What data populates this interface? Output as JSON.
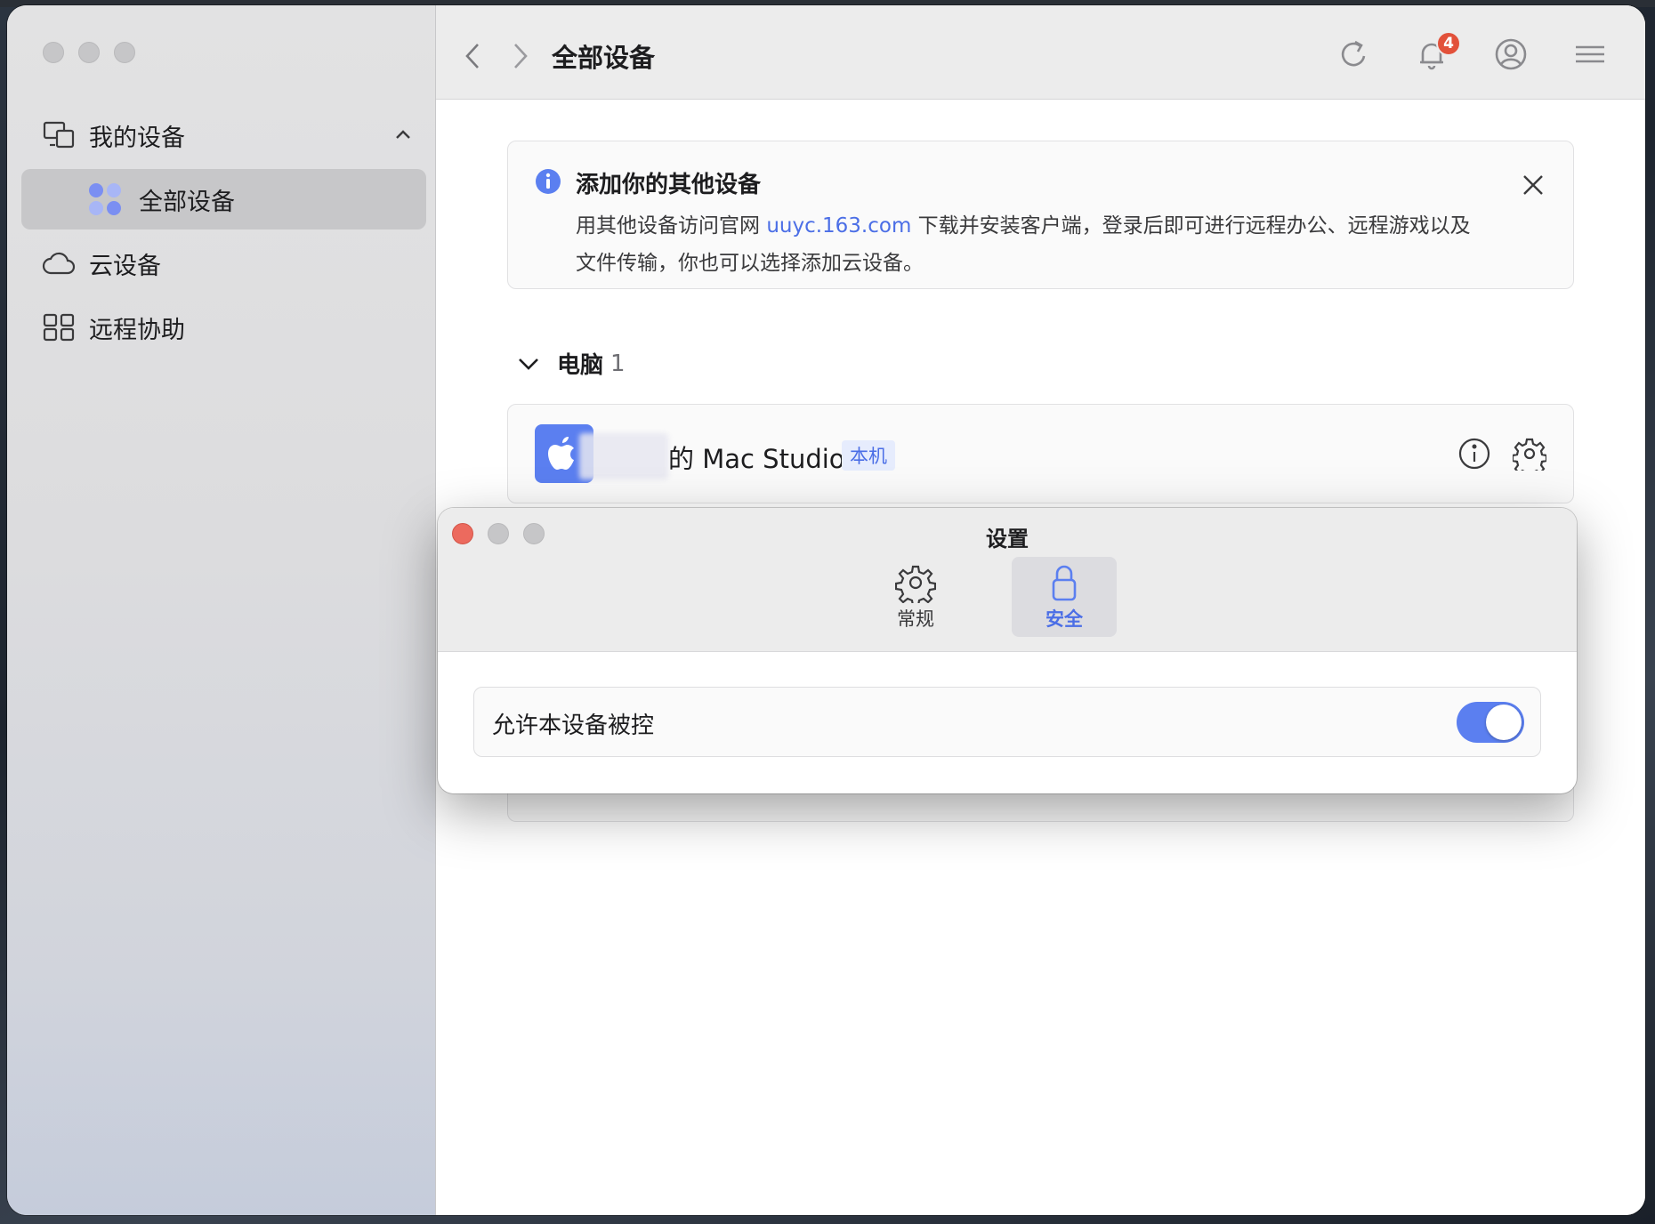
{
  "sidebar": {
    "group_label": "我的设备",
    "items": [
      {
        "label": "全部设备"
      },
      {
        "label": "云设备"
      },
      {
        "label": "远程协助"
      }
    ]
  },
  "titlebar": {
    "title": "全部设备",
    "notification_count": "4"
  },
  "banner": {
    "title": "添加你的其他设备",
    "text_before": "用其他设备访问官网 ",
    "link": "uuyc.163.com",
    "text_after": " 下载并安装客户端，登录后即可进行远程办公、远程游戏以及文件传输，你也可以选择添加云设备。"
  },
  "section": {
    "title": "电脑",
    "count": "1"
  },
  "device": {
    "name": "的 Mac Studio",
    "tag": "本机"
  },
  "dialog": {
    "title": "设置",
    "tabs": [
      {
        "label": "常规"
      },
      {
        "label": "安全"
      }
    ],
    "active_tab": "安全",
    "setting_label": "允许本设备被控",
    "setting_enabled": true
  },
  "colors": {
    "accent": "#5b7ff0",
    "badge": "#e2513a",
    "close_red": "#ec6a5e"
  }
}
